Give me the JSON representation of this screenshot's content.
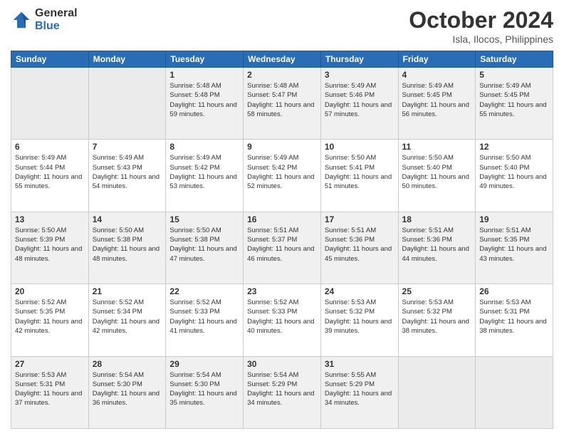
{
  "header": {
    "logo_general": "General",
    "logo_blue": "Blue",
    "month_title": "October 2024",
    "location": "Isla, Ilocos, Philippines"
  },
  "days_of_week": [
    "Sunday",
    "Monday",
    "Tuesday",
    "Wednesday",
    "Thursday",
    "Friday",
    "Saturday"
  ],
  "weeks": [
    [
      {
        "day": "",
        "empty": true
      },
      {
        "day": "",
        "empty": true
      },
      {
        "day": "1",
        "sunrise": "5:48 AM",
        "sunset": "5:48 PM",
        "daylight": "11 hours and 59 minutes."
      },
      {
        "day": "2",
        "sunrise": "5:48 AM",
        "sunset": "5:47 PM",
        "daylight": "11 hours and 58 minutes."
      },
      {
        "day": "3",
        "sunrise": "5:49 AM",
        "sunset": "5:46 PM",
        "daylight": "11 hours and 57 minutes."
      },
      {
        "day": "4",
        "sunrise": "5:49 AM",
        "sunset": "5:45 PM",
        "daylight": "11 hours and 56 minutes."
      },
      {
        "day": "5",
        "sunrise": "5:49 AM",
        "sunset": "5:45 PM",
        "daylight": "11 hours and 55 minutes."
      }
    ],
    [
      {
        "day": "6",
        "sunrise": "5:49 AM",
        "sunset": "5:44 PM",
        "daylight": "11 hours and 55 minutes."
      },
      {
        "day": "7",
        "sunrise": "5:49 AM",
        "sunset": "5:43 PM",
        "daylight": "11 hours and 54 minutes."
      },
      {
        "day": "8",
        "sunrise": "5:49 AM",
        "sunset": "5:42 PM",
        "daylight": "11 hours and 53 minutes."
      },
      {
        "day": "9",
        "sunrise": "5:49 AM",
        "sunset": "5:42 PM",
        "daylight": "11 hours and 52 minutes."
      },
      {
        "day": "10",
        "sunrise": "5:50 AM",
        "sunset": "5:41 PM",
        "daylight": "11 hours and 51 minutes."
      },
      {
        "day": "11",
        "sunrise": "5:50 AM",
        "sunset": "5:40 PM",
        "daylight": "11 hours and 50 minutes."
      },
      {
        "day": "12",
        "sunrise": "5:50 AM",
        "sunset": "5:40 PM",
        "daylight": "11 hours and 49 minutes."
      }
    ],
    [
      {
        "day": "13",
        "sunrise": "5:50 AM",
        "sunset": "5:39 PM",
        "daylight": "11 hours and 48 minutes."
      },
      {
        "day": "14",
        "sunrise": "5:50 AM",
        "sunset": "5:38 PM",
        "daylight": "11 hours and 48 minutes."
      },
      {
        "day": "15",
        "sunrise": "5:50 AM",
        "sunset": "5:38 PM",
        "daylight": "11 hours and 47 minutes."
      },
      {
        "day": "16",
        "sunrise": "5:51 AM",
        "sunset": "5:37 PM",
        "daylight": "11 hours and 46 minutes."
      },
      {
        "day": "17",
        "sunrise": "5:51 AM",
        "sunset": "5:36 PM",
        "daylight": "11 hours and 45 minutes."
      },
      {
        "day": "18",
        "sunrise": "5:51 AM",
        "sunset": "5:36 PM",
        "daylight": "11 hours and 44 minutes."
      },
      {
        "day": "19",
        "sunrise": "5:51 AM",
        "sunset": "5:35 PM",
        "daylight": "11 hours and 43 minutes."
      }
    ],
    [
      {
        "day": "20",
        "sunrise": "5:52 AM",
        "sunset": "5:35 PM",
        "daylight": "11 hours and 42 minutes."
      },
      {
        "day": "21",
        "sunrise": "5:52 AM",
        "sunset": "5:34 PM",
        "daylight": "11 hours and 42 minutes."
      },
      {
        "day": "22",
        "sunrise": "5:52 AM",
        "sunset": "5:33 PM",
        "daylight": "11 hours and 41 minutes."
      },
      {
        "day": "23",
        "sunrise": "5:52 AM",
        "sunset": "5:33 PM",
        "daylight": "11 hours and 40 minutes."
      },
      {
        "day": "24",
        "sunrise": "5:53 AM",
        "sunset": "5:32 PM",
        "daylight": "11 hours and 39 minutes."
      },
      {
        "day": "25",
        "sunrise": "5:53 AM",
        "sunset": "5:32 PM",
        "daylight": "11 hours and 38 minutes."
      },
      {
        "day": "26",
        "sunrise": "5:53 AM",
        "sunset": "5:31 PM",
        "daylight": "11 hours and 38 minutes."
      }
    ],
    [
      {
        "day": "27",
        "sunrise": "5:53 AM",
        "sunset": "5:31 PM",
        "daylight": "11 hours and 37 minutes."
      },
      {
        "day": "28",
        "sunrise": "5:54 AM",
        "sunset": "5:30 PM",
        "daylight": "11 hours and 36 minutes."
      },
      {
        "day": "29",
        "sunrise": "5:54 AM",
        "sunset": "5:30 PM",
        "daylight": "11 hours and 35 minutes."
      },
      {
        "day": "30",
        "sunrise": "5:54 AM",
        "sunset": "5:29 PM",
        "daylight": "11 hours and 34 minutes."
      },
      {
        "day": "31",
        "sunrise": "5:55 AM",
        "sunset": "5:29 PM",
        "daylight": "11 hours and 34 minutes."
      },
      {
        "day": "",
        "empty": true
      },
      {
        "day": "",
        "empty": true
      }
    ]
  ]
}
